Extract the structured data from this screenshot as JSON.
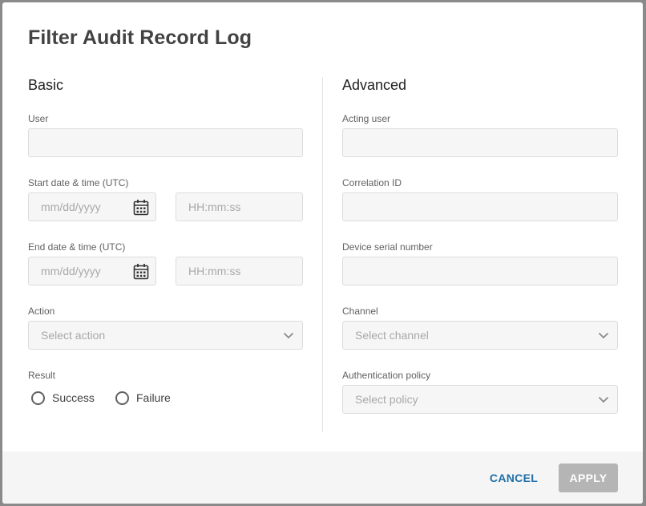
{
  "dialog": {
    "title": "Filter Audit Record Log",
    "basic": {
      "heading": "Basic",
      "user_label": "User",
      "start_label": "Start date & time (UTC)",
      "start_date_placeholder": "mm/dd/yyyy",
      "start_time_placeholder": "HH:mm:ss",
      "end_label": "End date & time (UTC)",
      "end_date_placeholder": "mm/dd/yyyy",
      "end_time_placeholder": "HH:mm:ss",
      "action_label": "Action",
      "action_placeholder": "Select action",
      "result_label": "Result",
      "result_options": [
        "Success",
        "Failure"
      ]
    },
    "advanced": {
      "heading": "Advanced",
      "acting_user_label": "Acting user",
      "correlation_label": "Correlation ID",
      "serial_label": "Device serial number",
      "channel_label": "Channel",
      "channel_placeholder": "Select channel",
      "auth_label": "Authentication policy",
      "auth_placeholder": "Select policy"
    },
    "footer": {
      "cancel_label": "CANCEL",
      "apply_label": "APPLY"
    }
  },
  "colors": {
    "accent": "#1f6fa8",
    "apply_disabled": "#b5b5b5",
    "field_bg": "#f6f6f6"
  }
}
